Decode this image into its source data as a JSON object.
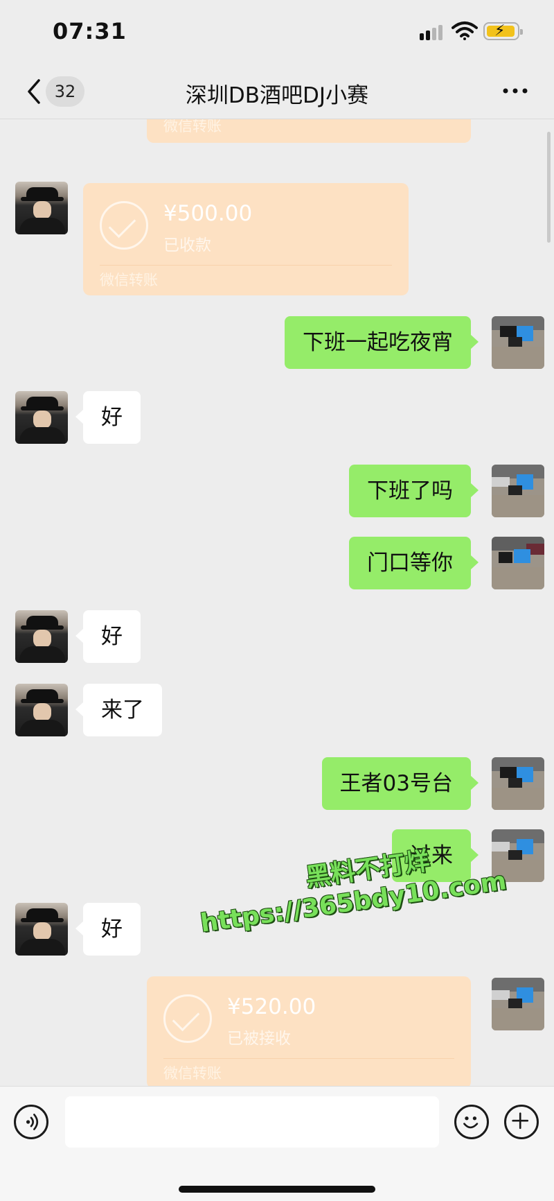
{
  "status_bar": {
    "time": "07:31"
  },
  "nav": {
    "unread_count": "32",
    "title": "深圳DB酒吧DJ小赛"
  },
  "messages": [
    {
      "type": "transfer",
      "side": "out",
      "amount": "",
      "status": "",
      "label": "微信转账",
      "partial": true
    },
    {
      "type": "transfer",
      "side": "in",
      "amount": "¥500.00",
      "status": "已收款",
      "label": "微信转账"
    },
    {
      "type": "text",
      "side": "out",
      "text": "下班一起吃夜宵"
    },
    {
      "type": "text",
      "side": "in",
      "text": "好"
    },
    {
      "type": "text",
      "side": "out",
      "text": "下班了吗"
    },
    {
      "type": "text",
      "side": "out",
      "text": "门口等你"
    },
    {
      "type": "text",
      "side": "in",
      "text": "好"
    },
    {
      "type": "text",
      "side": "in",
      "text": "来了"
    },
    {
      "type": "text",
      "side": "out",
      "text": "王者03号台"
    },
    {
      "type": "text",
      "side": "out",
      "text": "过来"
    },
    {
      "type": "text",
      "side": "in",
      "text": "好"
    },
    {
      "type": "transfer",
      "side": "out",
      "amount": "¥520.00",
      "status": "已被接收",
      "label": "微信转账"
    }
  ],
  "watermark": {
    "line1": "黑料不打烊",
    "line2": "https://365bdy10.com"
  },
  "input": {
    "value": "",
    "placeholder": ""
  },
  "icons": {
    "back": "chevron-left-icon",
    "more": "more-dots-icon",
    "voice": "voice-icon",
    "emoji": "emoji-icon",
    "plus": "plus-icon"
  },
  "colors": {
    "background": "#ededed",
    "outgoing_bubble": "#95ec69",
    "incoming_bubble": "#ffffff",
    "transfer_card": "#fde1c3",
    "watermark": "#78e05a"
  }
}
